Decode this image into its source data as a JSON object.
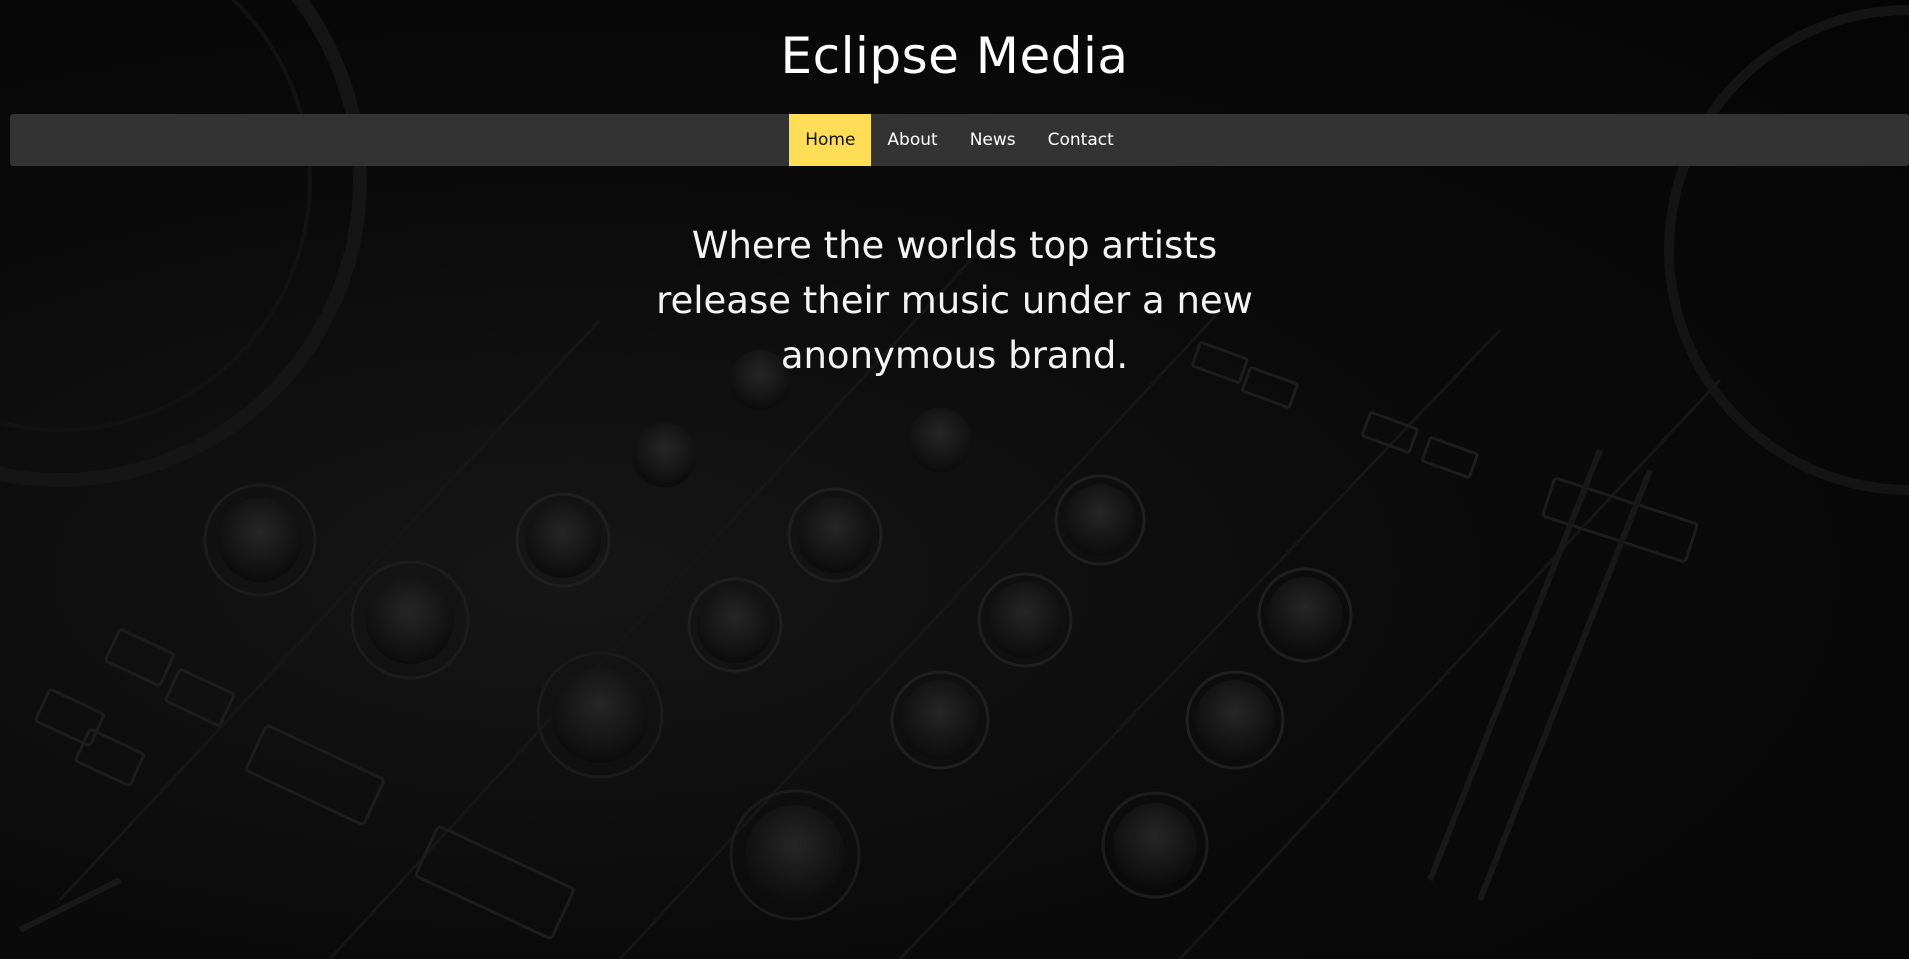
{
  "site": {
    "title": "Eclipse Media"
  },
  "nav": {
    "items": [
      {
        "label": "Home",
        "active": true
      },
      {
        "label": "About",
        "active": false
      },
      {
        "label": "News",
        "active": false
      },
      {
        "label": "Contact",
        "active": false
      }
    ]
  },
  "hero": {
    "tagline": "Where the worlds top artists release their music under a new anonymous brand."
  },
  "colors": {
    "accent": "#ffdd57",
    "navbar": "#333333",
    "background": "#060606",
    "text": "#ffffff"
  },
  "background_image": {
    "icon": "dj-mixer-background"
  }
}
